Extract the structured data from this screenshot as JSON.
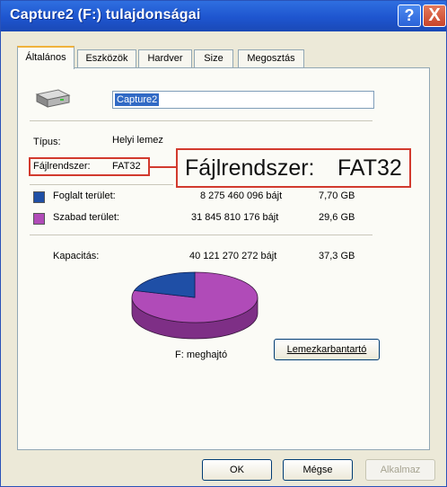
{
  "window": {
    "title": "Capture2 (F:) tulajdonságai",
    "help_label": "?",
    "close_label": "X"
  },
  "tabs": [
    {
      "label": "Általános",
      "active": true
    },
    {
      "label": "Eszközök"
    },
    {
      "label": "Hardver"
    },
    {
      "label": "Size"
    },
    {
      "label": "Megosztás"
    }
  ],
  "general": {
    "drive_name": "Capture2",
    "type_label": "Típus:",
    "type_value": "Helyi lemez",
    "fs_label": "Fájlrendszer:",
    "fs_value": "FAT32",
    "callout_label": "Fájlrendszer:",
    "callout_value": "FAT32",
    "used_label": "Foglalt terület:",
    "used_bytes": "8 275 460 096 bájt",
    "used_gb": "7,70 GB",
    "used_color": "#1f4fa6",
    "free_label": "Szabad terület:",
    "free_bytes": "31 845 810 176 bájt",
    "free_gb": "29,6 GB",
    "free_color": "#b04bb8",
    "capacity_label": "Kapacitás:",
    "capacity_bytes": "40 121 270 272 bájt",
    "capacity_gb": "37,3 GB",
    "used_fraction": 0.206,
    "drive_caption": "F: meghajtó",
    "cleanup_button": "Lemezkarbantartó"
  },
  "footer": {
    "ok_label": "OK",
    "cancel_label": "Mégse",
    "apply_label": "Alkalmaz"
  }
}
